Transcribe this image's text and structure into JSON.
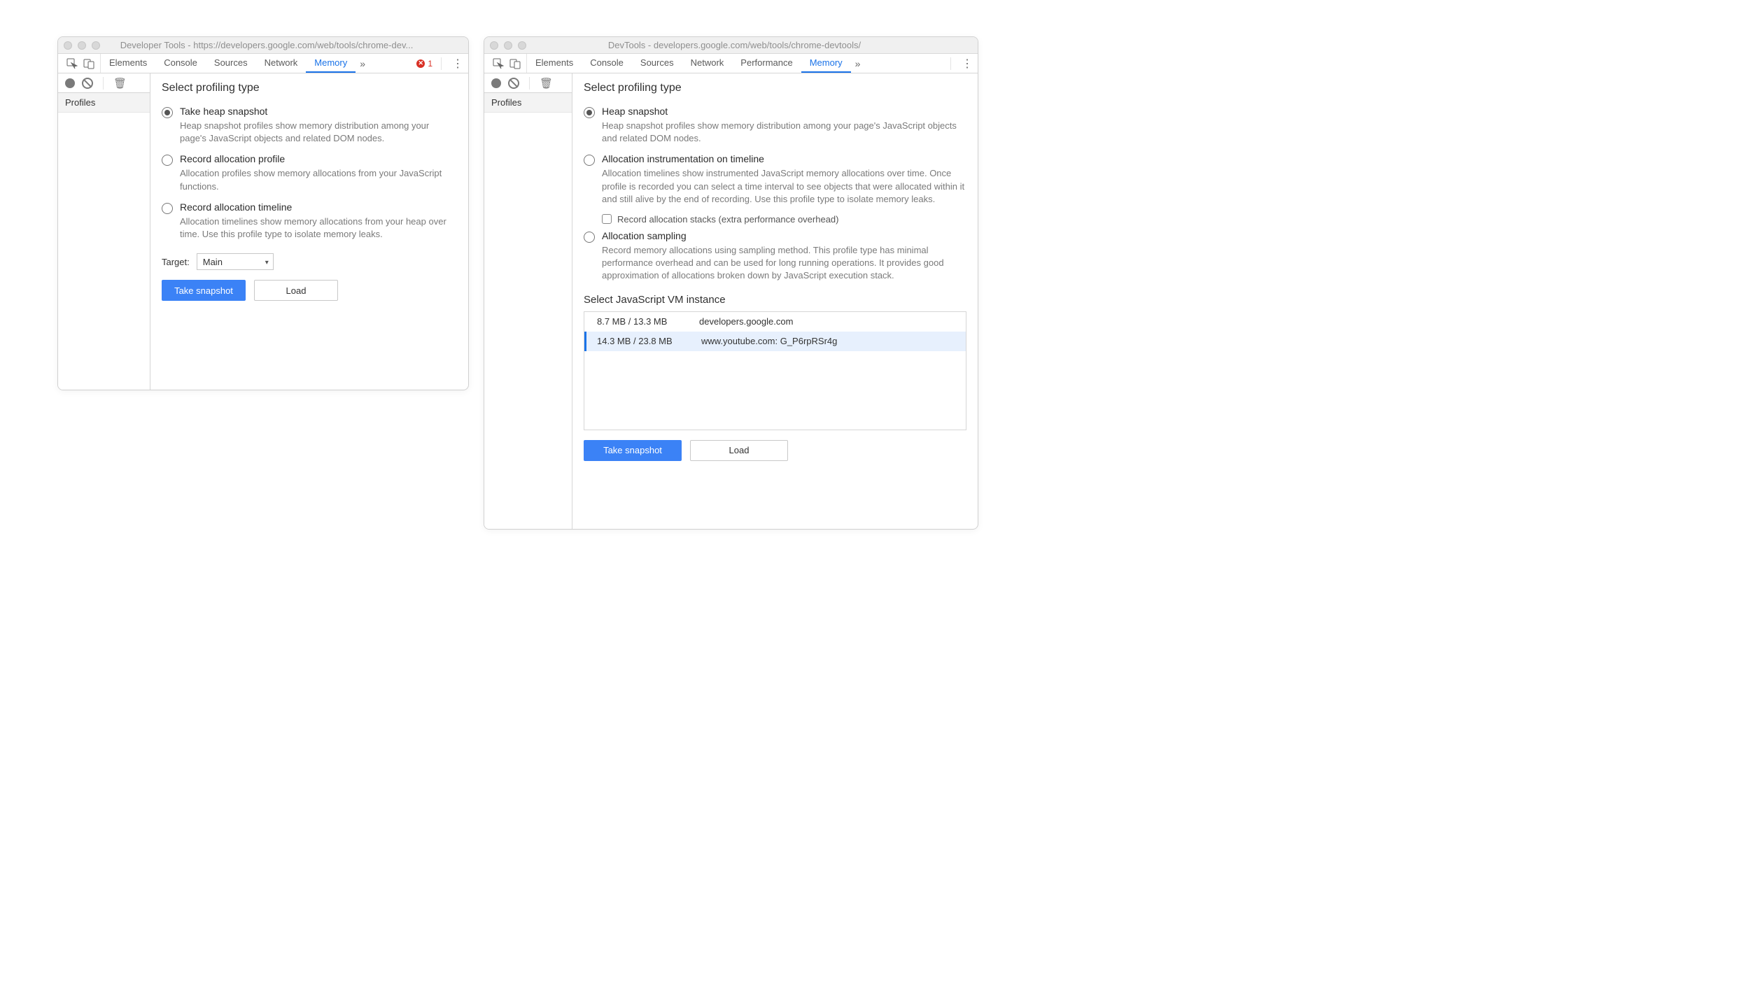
{
  "left": {
    "title": "Developer Tools - https://developers.google.com/web/tools/chrome-dev...",
    "tabs": [
      "Elements",
      "Console",
      "Sources",
      "Network",
      "Memory"
    ],
    "active_tab": "Memory",
    "error_count": "1",
    "sidebar": {
      "profiles": "Profiles"
    },
    "heading": "Select profiling type",
    "options": [
      {
        "title": "Take heap snapshot",
        "desc": "Heap snapshot profiles show memory distribution among your page's JavaScript objects and related DOM nodes.",
        "checked": true
      },
      {
        "title": "Record allocation profile",
        "desc": "Allocation profiles show memory allocations from your JavaScript functions.",
        "checked": false
      },
      {
        "title": "Record allocation timeline",
        "desc": "Allocation timelines show memory allocations from your heap over time. Use this profile type to isolate memory leaks.",
        "checked": false
      }
    ],
    "target_label": "Target:",
    "target_value": "Main",
    "buttons": {
      "primary": "Take snapshot",
      "load": "Load"
    }
  },
  "right": {
    "title": "DevTools - developers.google.com/web/tools/chrome-devtools/",
    "tabs": [
      "Elements",
      "Console",
      "Sources",
      "Network",
      "Performance",
      "Memory"
    ],
    "active_tab": "Memory",
    "sidebar": {
      "profiles": "Profiles"
    },
    "heading": "Select profiling type",
    "options": [
      {
        "title": "Heap snapshot",
        "desc": "Heap snapshot profiles show memory distribution among your page's JavaScript objects and related DOM nodes.",
        "checked": true
      },
      {
        "title": "Allocation instrumentation on timeline",
        "desc": "Allocation timelines show instrumented JavaScript memory allocations over time. Once profile is recorded you can select a time interval to see objects that were allocated within it and still alive by the end of recording. Use this profile type to isolate memory leaks.",
        "checked": false
      },
      {
        "title": "Allocation sampling",
        "desc": "Record memory allocations using sampling method. This profile type has minimal performance overhead and can be used for long running operations. It provides good approximation of allocations broken down by JavaScript execution stack.",
        "checked": false
      }
    ],
    "suboption_label": "Record allocation stacks (extra performance overhead)",
    "vm_heading": "Select JavaScript VM instance",
    "vm_instances": [
      {
        "mem": "8.7 MB / 13.3 MB",
        "host": "developers.google.com",
        "selected": false
      },
      {
        "mem": "14.3 MB / 23.8 MB",
        "host": "www.youtube.com: G_P6rpRSr4g",
        "selected": true
      }
    ],
    "buttons": {
      "primary": "Take snapshot",
      "load": "Load"
    }
  }
}
